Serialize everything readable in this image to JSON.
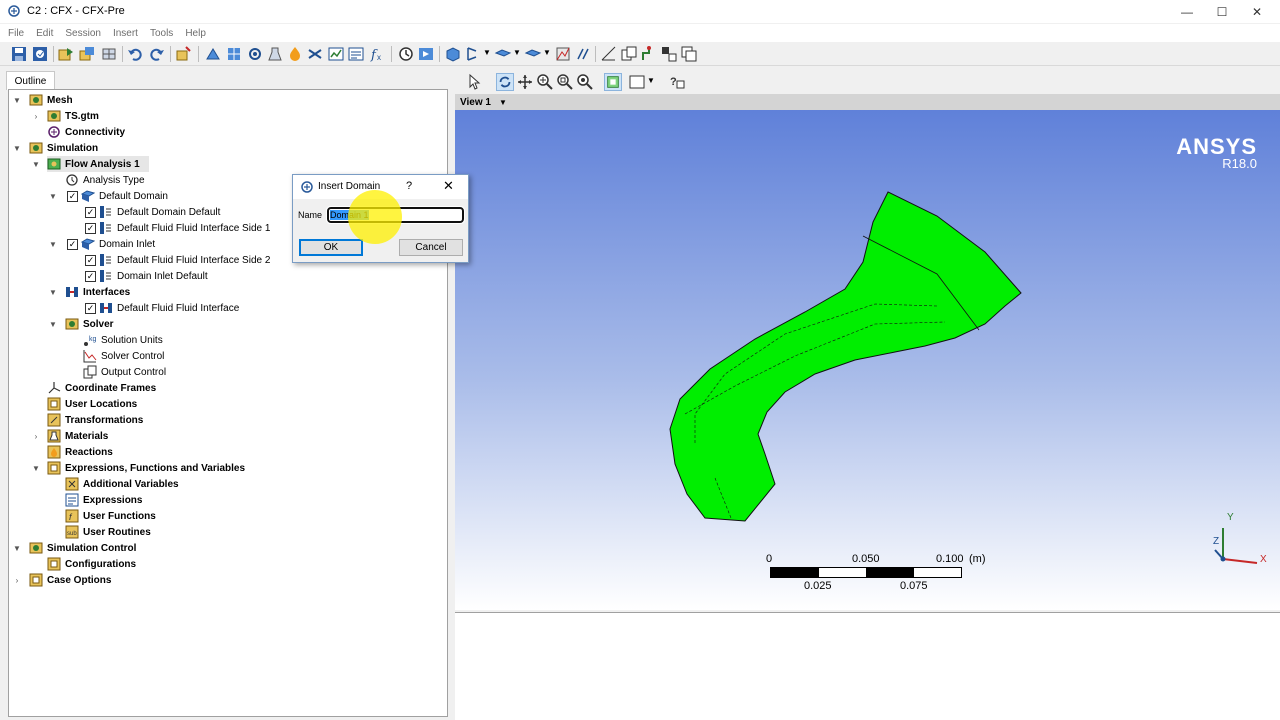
{
  "window": {
    "title": "C2 : CFX - CFX-Pre",
    "minimize": "—",
    "maximize": "☐",
    "close": "✕"
  },
  "menu": [
    "File",
    "Edit",
    "Session",
    "Insert",
    "Tools",
    "Help"
  ],
  "outline_tab": "Outline",
  "tree": {
    "mesh": "Mesh",
    "ts_gtm": "TS.gtm",
    "connectivity": "Connectivity",
    "simulation": "Simulation",
    "flow_analysis": "Flow Analysis 1",
    "analysis_type": "Analysis Type",
    "default_domain": "Default Domain",
    "default_domain_default": "Default Domain Default",
    "ffi_side1": "Default Fluid Fluid Interface Side 1",
    "domain_inlet": "Domain Inlet",
    "ffi_side2": "Default Fluid Fluid Interface Side 2",
    "domain_inlet_default": "Domain Inlet Default",
    "interfaces": "Interfaces",
    "ffi": "Default Fluid Fluid Interface",
    "solver": "Solver",
    "solution_units": "Solution Units",
    "solver_control": "Solver Control",
    "output_control": "Output Control",
    "coordinate_frames": "Coordinate Frames",
    "user_locations": "User Locations",
    "transformations": "Transformations",
    "materials": "Materials",
    "reactions": "Reactions",
    "expressions_functions_variables": "Expressions, Functions and Variables",
    "additional_variables": "Additional Variables",
    "expressions": "Expressions",
    "user_functions": "User Functions",
    "user_routines": "User Routines",
    "simulation_control": "Simulation Control",
    "configurations": "Configurations",
    "case_options": "Case Options"
  },
  "viewer": {
    "view_label": "View 1",
    "logo": "ANSYS",
    "version": "R18.0",
    "geometry_color": "#00ee00",
    "scale": {
      "top_labels": [
        "0",
        "0.050",
        "0.100",
        "(m)"
      ],
      "bottom_labels": [
        "0.025",
        "0.075"
      ]
    },
    "axes": {
      "x": "X",
      "y": "Y",
      "z": "Z"
    }
  },
  "dialog": {
    "title": "Insert Domain",
    "help": "?",
    "close": "✕",
    "name_label": "Name",
    "name_value": "Domain 1",
    "ok": "OK",
    "cancel": "Cancel"
  },
  "colors": {
    "accent": "#0078d7",
    "viewport_top": "#5b7dd8",
    "viewport_bottom": "#ffffff"
  }
}
